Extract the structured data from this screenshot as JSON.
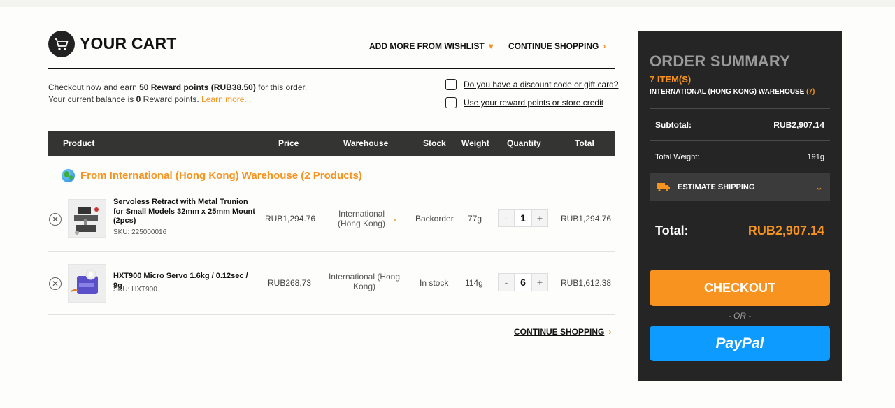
{
  "header": {
    "title": "YOUR CART",
    "wishlist_link": "ADD MORE FROM WISHLIST",
    "continue_link": "CONTINUE SHOPPING"
  },
  "rewards": {
    "line1_pre": "Checkout now and earn ",
    "points": "50 Reward points",
    "points_value": "(RUB38.50)",
    "line1_post": " for this order.",
    "line2_pre": "Your current balance is ",
    "balance": "0",
    "line2_post": " Reward points.",
    "learn_more": "Learn more..."
  },
  "options": {
    "discount_label": "Do you have a discount code or gift card?",
    "reward_label": "Use your reward points or store credit"
  },
  "table": {
    "headers": {
      "product": "Product",
      "price": "Price",
      "warehouse": "Warehouse",
      "stock": "Stock",
      "weight": "Weight",
      "quantity": "Quantity",
      "total": "Total"
    },
    "group_title": "From International (Hong Kong) Warehouse (2 Products)",
    "rows": [
      {
        "name": "Servoless Retract with Metal Trunion for Small Models 32mm x 25mm Mount (2pcs)",
        "sku": "SKU: 225000016",
        "price": "RUB1,294.76",
        "warehouse": "International (Hong Kong)",
        "stock": "Backorder",
        "weight": "77g",
        "qty": "1",
        "total": "RUB1,294.76"
      },
      {
        "name": "HXT900 Micro Servo 1.6kg / 0.12sec / 9g",
        "sku": "SKU: HXT900",
        "price": "RUB268.73",
        "warehouse": "International (Hong Kong)",
        "stock": "In stock",
        "weight": "114g",
        "qty": "6",
        "total": "RUB1,612.38"
      }
    ],
    "continue_link": "CONTINUE SHOPPING"
  },
  "summary": {
    "title": "ORDER SUMMARY",
    "items": "7 ITEM(S)",
    "warehouse": "INTERNATIONAL (HONG KONG) WAREHOUSE",
    "warehouse_count": "(7)",
    "subtotal_label": "Subtotal:",
    "subtotal_value": "RUB2,907.14",
    "weight_label": "Total Weight:",
    "weight_value": "191g",
    "estimate_label": "ESTIMATE SHIPPING",
    "total_label": "Total:",
    "total_value": "RUB2,907.14",
    "checkout_label": "CHECKOUT",
    "or_label": "- OR -",
    "paypal_label": "PayPal"
  },
  "colors": {
    "accent": "#f7931e",
    "dark_panel": "#252525",
    "table_header": "#343432",
    "paypal": "#0d9bff"
  }
}
